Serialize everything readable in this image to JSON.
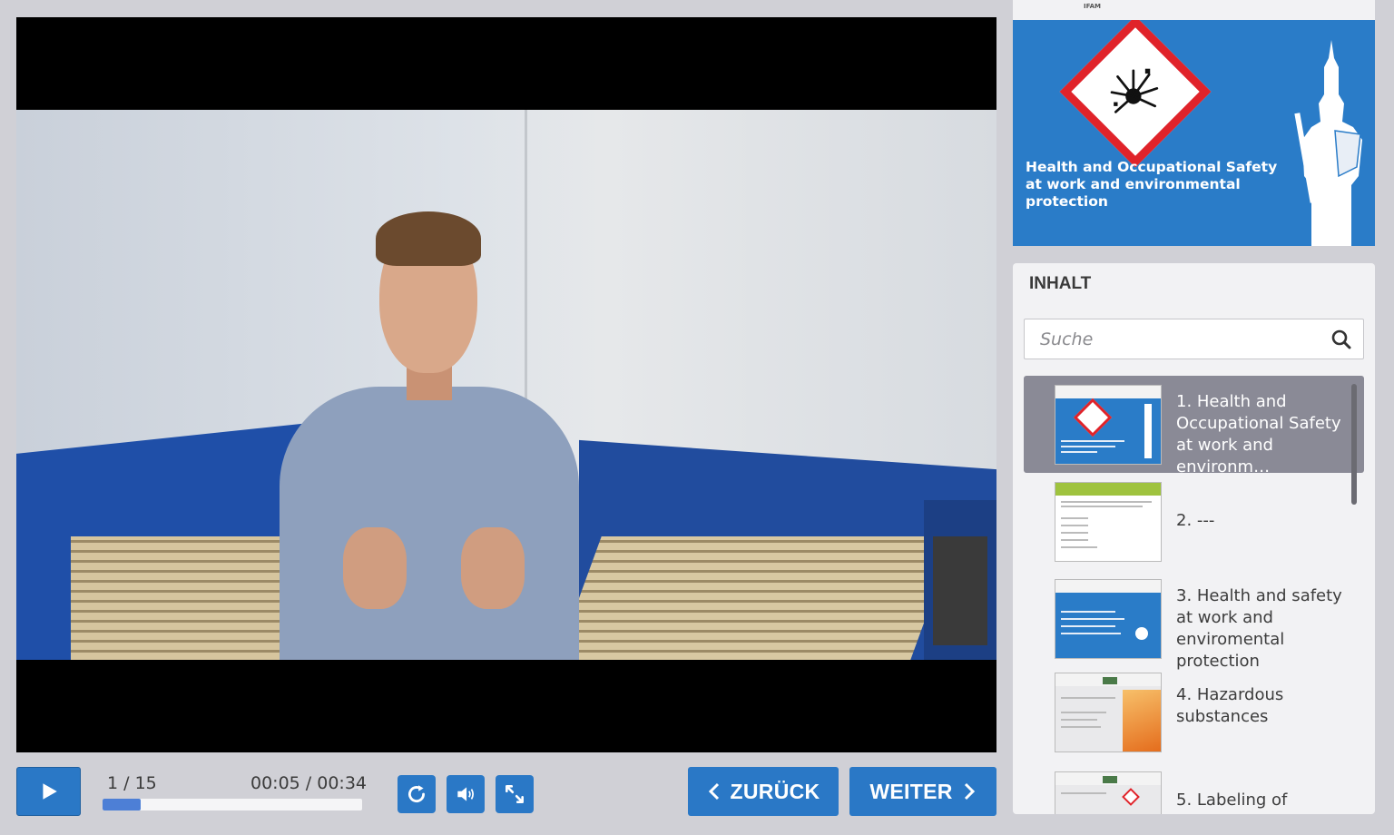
{
  "controls": {
    "slide_counter": "1 / 15",
    "time": "00:05 / 00:34",
    "progress_fraction": 0.147,
    "back_label": "ZURÜCK",
    "next_label": "WEITER"
  },
  "banner": {
    "logo_text": "IFAM",
    "title": "Health and Occupational Safety at work and environmental protection"
  },
  "toc": {
    "heading": "INHALT",
    "search_placeholder": "Suche",
    "items": [
      {
        "label": "1. Health and Occupational Safety at work and environm…",
        "active": true
      },
      {
        "label": "2. ---",
        "active": false
      },
      {
        "label": "3. Health and safety at work and enviromental protection",
        "active": false
      },
      {
        "label": "4. Hazardous substances",
        "active": false
      },
      {
        "label": "5. Labeling of",
        "active": false
      }
    ]
  },
  "colors": {
    "accent": "#2a78c6",
    "banner": "#2a7cc8",
    "hazard_red": "#e0232a",
    "active_item": "#8a8a96"
  }
}
